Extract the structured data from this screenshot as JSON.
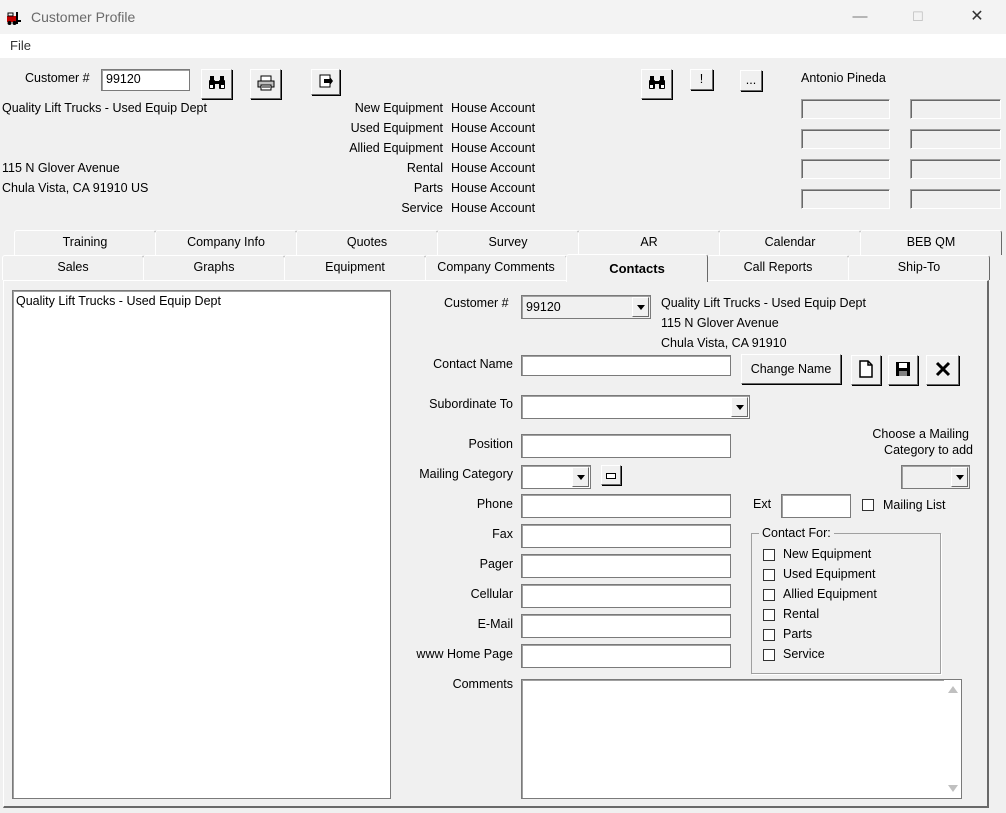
{
  "window": {
    "title": "Customer Profile",
    "controls": {
      "minimize": "—",
      "maximize": "☐",
      "close": "✕"
    }
  },
  "menu": {
    "file": "File"
  },
  "header": {
    "customer_label": "Customer #",
    "customer_number": "99120",
    "company_name": "Quality Lift Trucks - Used Equip Dept",
    "address1": "115 N Glover Avenue",
    "address2": "Chula Vista, CA  91910  US",
    "accounts": [
      {
        "category": "New Equipment",
        "account": "House Account"
      },
      {
        "category": "Used Equipment",
        "account": "House Account"
      },
      {
        "category": "Allied Equipment",
        "account": "House Account"
      },
      {
        "category": "Rental",
        "account": "House Account"
      },
      {
        "category": "Parts",
        "account": "House Account"
      },
      {
        "category": "Service",
        "account": "House Account"
      }
    ],
    "exclaim_label": "!",
    "ellipsis_label": "...",
    "user_name": "Antonio Pineda"
  },
  "tabs": {
    "row_back": [
      "Training",
      "Company Info",
      "Quotes",
      "Survey",
      "AR",
      "Calendar",
      "BEB QM"
    ],
    "row_front": [
      "Sales",
      "Graphs",
      "Equipment",
      "Company Comments",
      "Contacts",
      "Call Reports",
      "Ship-To"
    ],
    "active": "Contacts"
  },
  "contacts": {
    "list_items": [
      "Quality Lift Trucks - Used Equip Dept"
    ],
    "customer_label": "Customer #",
    "customer_value": "99120",
    "company_name": "Quality Lift Trucks - Used Equip Dept",
    "address1": "115 N Glover Avenue",
    "address2": "Chula Vista, CA 91910",
    "contact_name_label": "Contact Name",
    "change_name_label": "Change Name",
    "subordinate_label": "Subordinate To",
    "position_label": "Position",
    "mailing_category_label": "Mailing Category",
    "choose_mailing_1": "Choose a Mailing",
    "choose_mailing_2": "Category to add",
    "phone_label": "Phone",
    "ext_label": "Ext",
    "mailing_list_label": "Mailing List",
    "fax_label": "Fax",
    "pager_label": "Pager",
    "cellular_label": "Cellular",
    "email_label": "E-Mail",
    "homepage_label": "www Home Page",
    "comments_label": "Comments",
    "contact_for": {
      "legend": "Contact For:",
      "items": [
        "New Equipment",
        "Used Equipment",
        "Allied Equipment",
        "Rental",
        "Parts",
        "Service"
      ]
    }
  }
}
